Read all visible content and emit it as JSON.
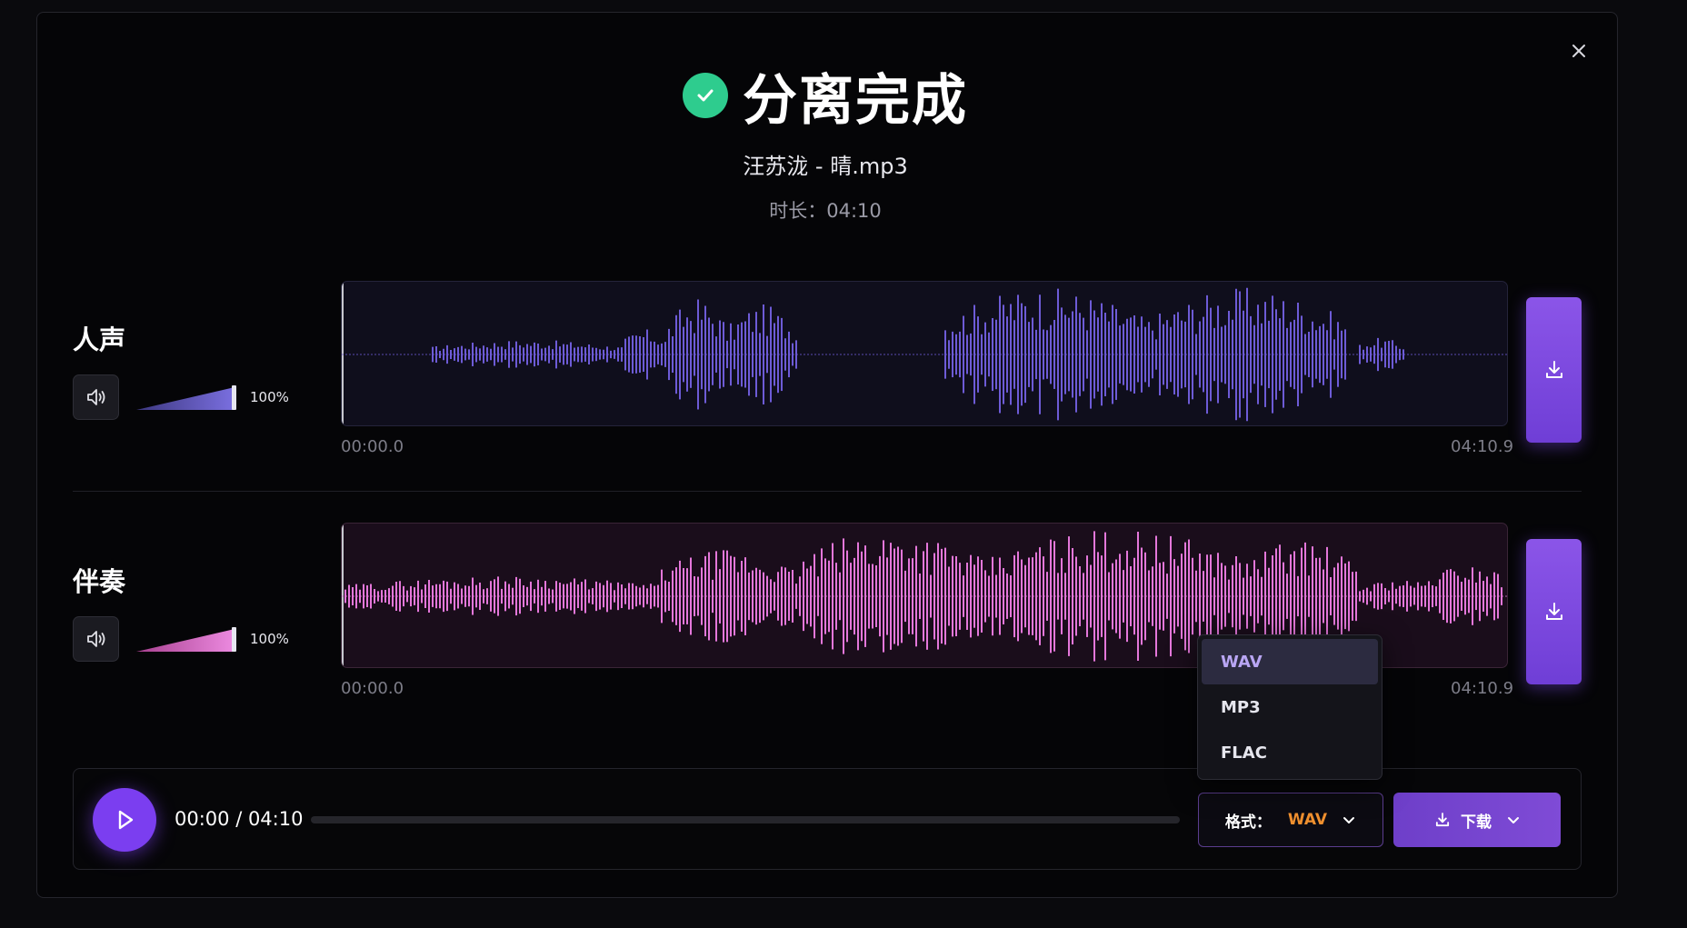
{
  "header": {
    "title": "分离完成",
    "filename": "汪苏泷 - 晴.mp3",
    "duration": "时长：04:10"
  },
  "tracks": [
    {
      "label": "人声",
      "volume": "100%",
      "volume_level": 1.0,
      "time_start": "00:00.0",
      "time_end": "04:10.9",
      "color": "#6d5bd6"
    },
    {
      "label": "伴奏",
      "volume": "100%",
      "volume_level": 1.0,
      "time_start": "00:00.0",
      "time_end": "04:10.9",
      "color": "#e477da"
    }
  ],
  "player": {
    "time": "00:00 / 04:10",
    "progress": 0.0,
    "format_label": "格式：",
    "format_value": "WAV",
    "download_label": "下载"
  },
  "format_options": [
    "WAV",
    "MP3",
    "FLAC"
  ],
  "colors": {
    "accent": "#7b3ef0",
    "success": "#2ecc8e",
    "format_highlight": "#f0902f"
  },
  "icons": {
    "close": "close-icon",
    "check": "check-icon",
    "volume": "volume-icon",
    "download": "download-icon",
    "play": "play-icon",
    "chevron": "chevron-down-icon"
  }
}
